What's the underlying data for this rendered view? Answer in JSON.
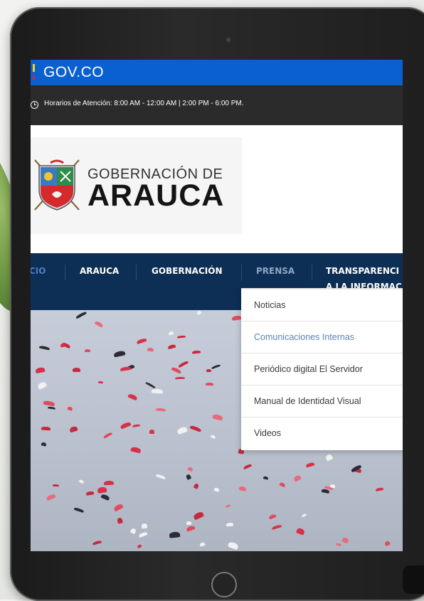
{
  "gov_bar": {
    "label": "GOV.CO"
  },
  "hours_bar": {
    "text": "Horarios de Atención: 8:00 AM - 12:00 AM | 2:00 PM - 6:00 PM."
  },
  "logo": {
    "line1": "GOBERNACIÓN DE",
    "line2": "ARAUCA"
  },
  "nav": {
    "items": [
      {
        "label": "CIO",
        "active": false
      },
      {
        "label": "ARAUCA",
        "active": false
      },
      {
        "label": "GOBERNACIÓN",
        "active": false
      },
      {
        "label": "PRENSA",
        "active": true
      },
      {
        "label": "TRANSPARENCI",
        "active": false
      },
      {
        "label": "A LA INFORMAC",
        "active": false
      }
    ]
  },
  "dropdown": {
    "items": [
      {
        "label": "Noticias",
        "active": false
      },
      {
        "label": "Comunicaciones Internas",
        "active": true
      },
      {
        "label": "Periódico digital El Servidor",
        "active": false
      },
      {
        "label": "Manual de Identidad Visual",
        "active": false
      },
      {
        "label": "Videos",
        "active": false
      }
    ]
  },
  "colors": {
    "gov_blue": "#0a60d0",
    "hours_bg": "#2b2b2b",
    "nav_bg": "#0d2e55",
    "active_link": "#5a82b7"
  },
  "icons": {
    "clock": "clock-icon",
    "crest": "coat-of-arms-icon"
  }
}
